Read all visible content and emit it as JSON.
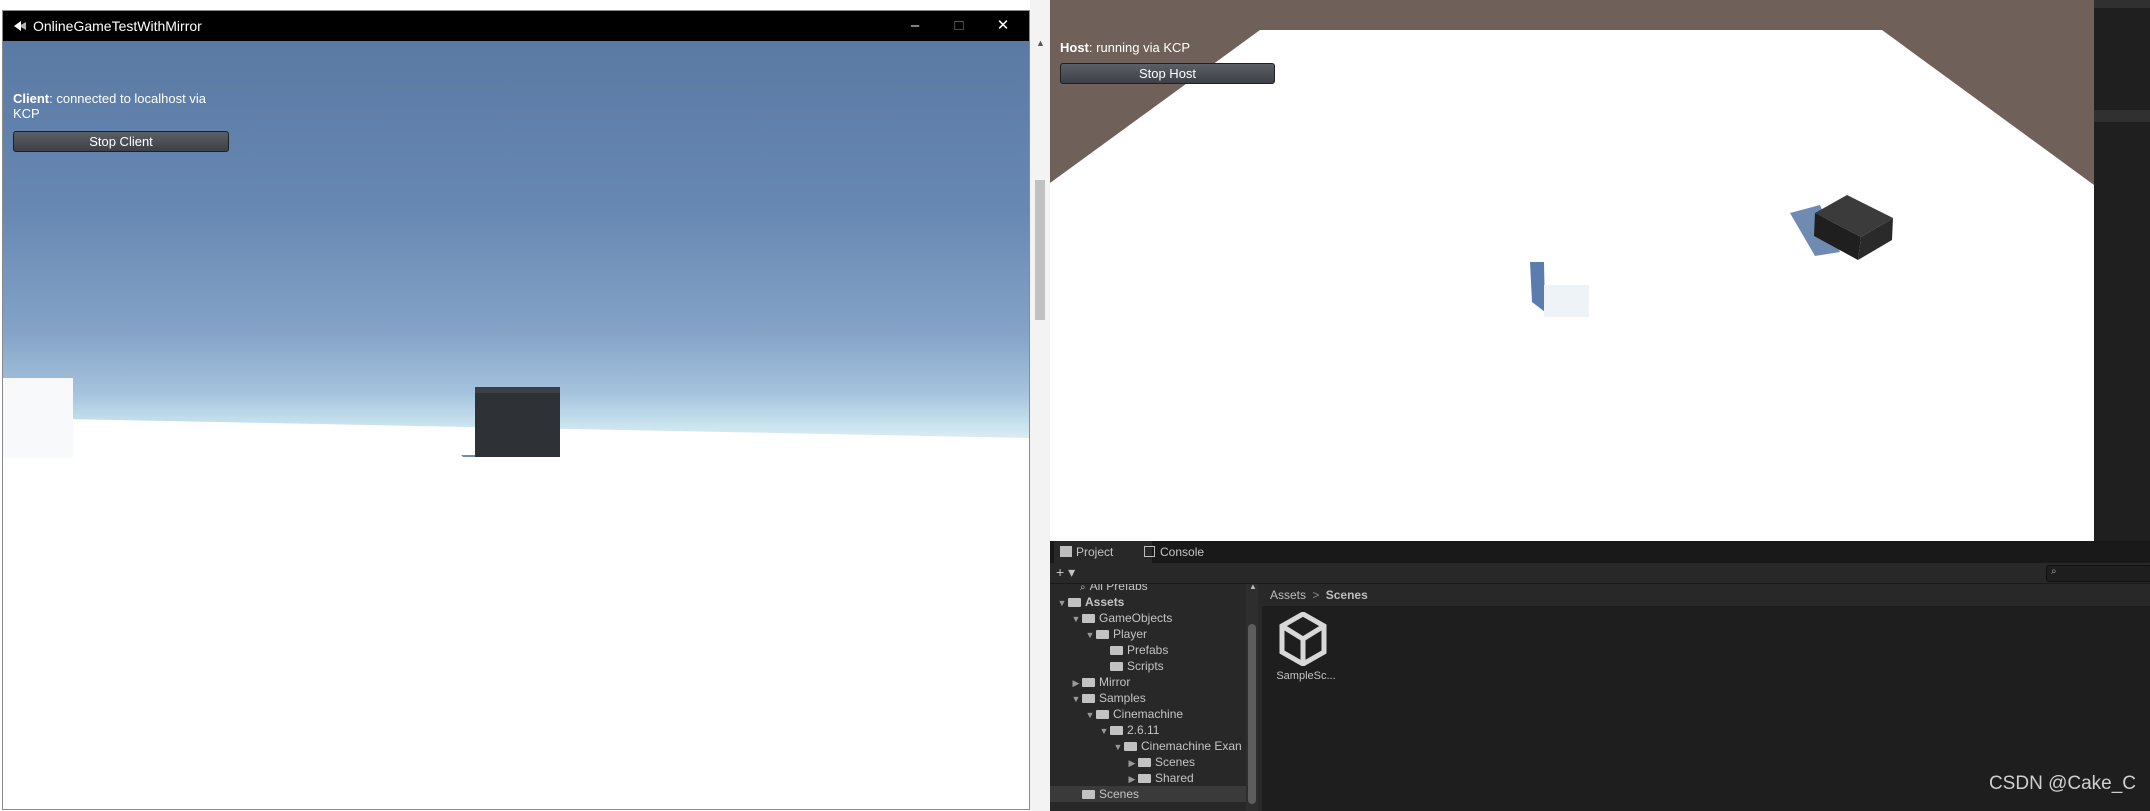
{
  "client_window": {
    "title": "OnlineGameTestWithMirror",
    "controls": {
      "minimize": "–",
      "maximize": "□",
      "close": "✕"
    },
    "status_label": "Client",
    "status_text": ": connected to localhost via KCP",
    "stop_button": "Stop Client"
  },
  "editor": {
    "game_view": {
      "status_label": "Host",
      "status_text": ": running via KCP",
      "stop_button": "Stop Host"
    },
    "tabs": [
      {
        "label": "Project",
        "icon": "folder-icon"
      },
      {
        "label": "Console",
        "icon": "console-icon"
      }
    ],
    "toolbar": {
      "add_label": "+ ▾"
    },
    "tree": {
      "search_item": "All Prefabs",
      "items": [
        {
          "label": "Assets",
          "indent": 0,
          "arrow": "▼",
          "bold": true
        },
        {
          "label": "GameObjects",
          "indent": 1,
          "arrow": "▼"
        },
        {
          "label": "Player",
          "indent": 2,
          "arrow": "▼"
        },
        {
          "label": "Prefabs",
          "indent": 3,
          "arrow": ""
        },
        {
          "label": "Scripts",
          "indent": 3,
          "arrow": ""
        },
        {
          "label": "Mirror",
          "indent": 1,
          "arrow": "▶"
        },
        {
          "label": "Samples",
          "indent": 1,
          "arrow": "▼"
        },
        {
          "label": "Cinemachine",
          "indent": 2,
          "arrow": "▼"
        },
        {
          "label": "2.6.11",
          "indent": 3,
          "arrow": "▼"
        },
        {
          "label": "Cinemachine Exan",
          "indent": 4,
          "arrow": "▼"
        },
        {
          "label": "Scenes",
          "indent": 5,
          "arrow": "▶"
        },
        {
          "label": "Shared",
          "indent": 5,
          "arrow": "▶"
        },
        {
          "label": "Scenes",
          "indent": 1,
          "arrow": ""
        }
      ]
    },
    "breadcrumb": {
      "root": "Assets",
      "separator": ">",
      "current": "Scenes"
    },
    "asset": {
      "name": "SampleSc...",
      "icon": "unity-scene-icon"
    }
  },
  "watermark": "CSDN @Cake_C"
}
